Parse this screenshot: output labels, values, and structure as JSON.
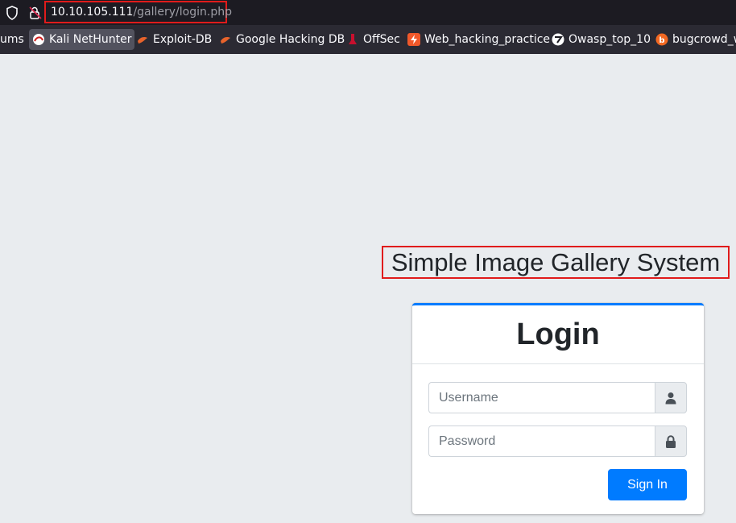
{
  "browser": {
    "url_host": "10.10.105.111",
    "url_path": "/gallery/login.php",
    "icons": {
      "security": "shield-icon",
      "connection": "lock-slash-icon"
    }
  },
  "bookmarks": [
    {
      "label": "ums",
      "icon": "none"
    },
    {
      "label": "Kali NetHunter",
      "icon": "kali-nethunter-icon"
    },
    {
      "label": "Exploit-DB",
      "icon": "exploit-db-icon"
    },
    {
      "label": "Google Hacking DB",
      "icon": "ghdb-icon"
    },
    {
      "label": "OffSec",
      "icon": "offsec-icon"
    },
    {
      "label": "Web_hacking_practice",
      "icon": "bolt-icon"
    },
    {
      "label": "Owasp_top_10",
      "icon": "owasp-icon"
    },
    {
      "label": "bugcrowd_w",
      "icon": "bugcrowd-icon"
    }
  ],
  "page": {
    "app_title": "Simple Image Gallery System",
    "login": {
      "heading": "Login",
      "username_placeholder": "Username",
      "password_placeholder": "Password",
      "submit_label": "Sign In"
    }
  },
  "colors": {
    "page_background": "#e9ecef",
    "primary": "#007bff",
    "highlight_box": "#e01b1b",
    "urlbar_background": "#1c1b22",
    "bookmarks_background": "#2b2a33"
  }
}
